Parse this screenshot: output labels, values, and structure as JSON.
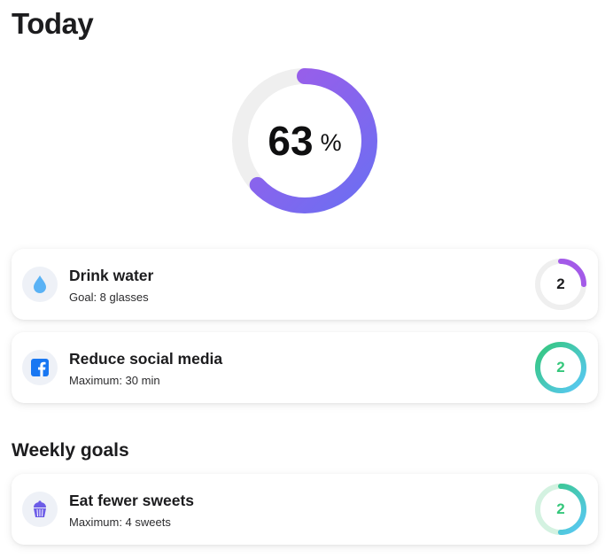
{
  "header": {
    "title": "Today"
  },
  "progress": {
    "value": "63",
    "unit": "%",
    "fraction": 0.63,
    "gradient_start": "#a35ae8",
    "gradient_end": "#6b6ff2",
    "track": "#eeeeee"
  },
  "habits": [
    {
      "title": "Drink water",
      "subtitle": "Goal: 8 glasses",
      "count": "2",
      "icon": "water-drop-icon",
      "progress": 0.25,
      "count_color": "#1c1c1e",
      "ring_colors": [
        "#a35ae8",
        "#a35ae8"
      ]
    },
    {
      "title": "Reduce social media",
      "subtitle": "Maximum: 30 min",
      "count": "2",
      "icon": "facebook-icon",
      "progress": 1.0,
      "count_color": "#34c77b",
      "ring_colors": [
        "#34c77b",
        "#5ac8fa"
      ]
    }
  ],
  "weekly": {
    "title": "Weekly goals",
    "goals": [
      {
        "title": "Eat fewer sweets",
        "subtitle": "Maximum: 4 sweets",
        "count": "2",
        "icon": "cupcake-icon",
        "progress": 0.5,
        "count_color": "#34c77b",
        "ring_colors": [
          "#34c77b",
          "#5ac8fa"
        ]
      }
    ]
  }
}
